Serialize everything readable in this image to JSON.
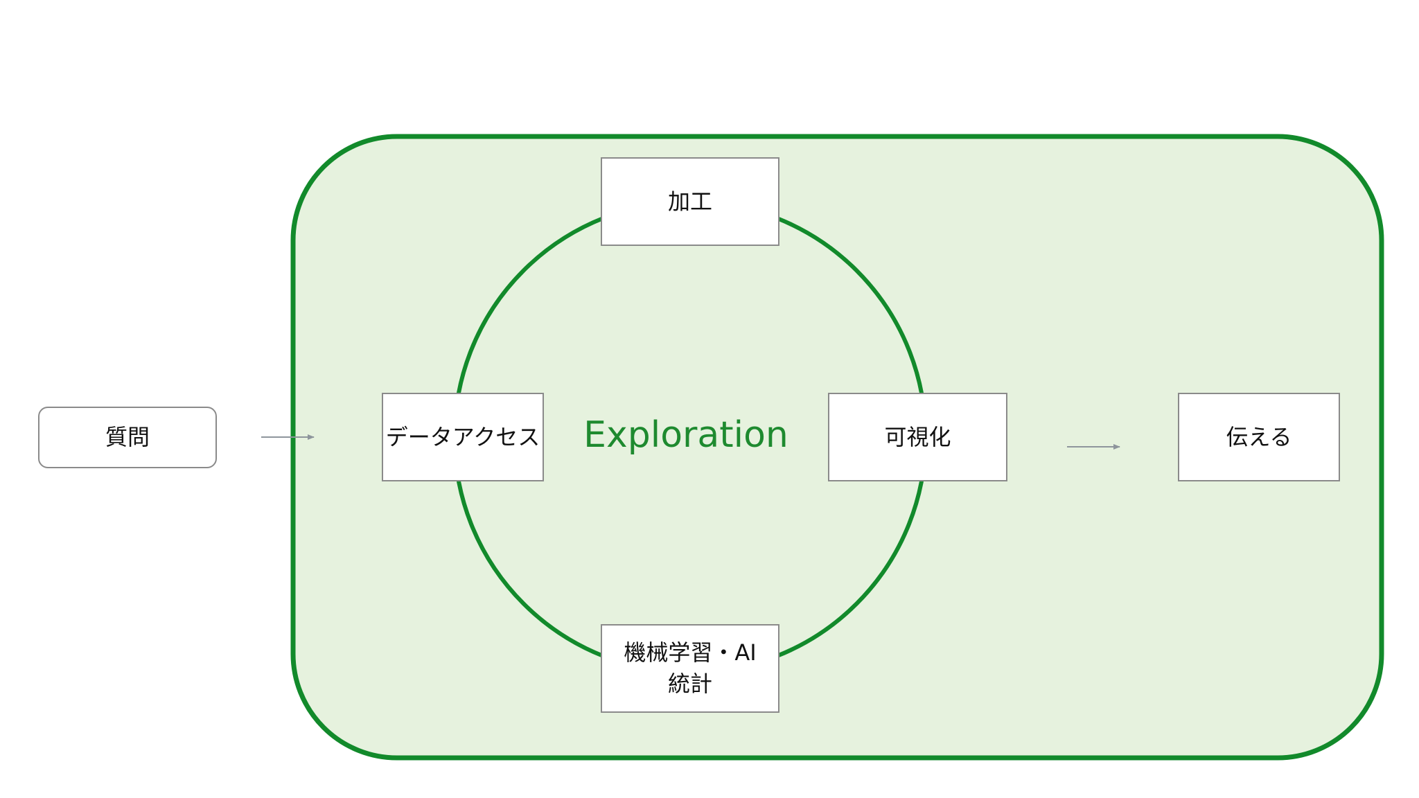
{
  "diagram": {
    "title": "",
    "colors": {
      "region_fill": "#e6f2de",
      "region_stroke": "#128a2b",
      "cycle_stroke": "#128a2b",
      "label_color": "#1e8a2f",
      "box_border": "#8a8a8a",
      "arrow_color": "#8e959c"
    },
    "region_label": "Exploration",
    "nodes": {
      "question": "質問",
      "data_access": "データアクセス",
      "processing": "加工",
      "visualization": "可視化",
      "ml_line1": "機械学習・AI",
      "ml_line2": "統計",
      "communicate": "伝える"
    },
    "edges": [
      {
        "from": "質問",
        "to": "Exploration"
      },
      {
        "from": "Exploration",
        "to": "伝える"
      }
    ]
  }
}
